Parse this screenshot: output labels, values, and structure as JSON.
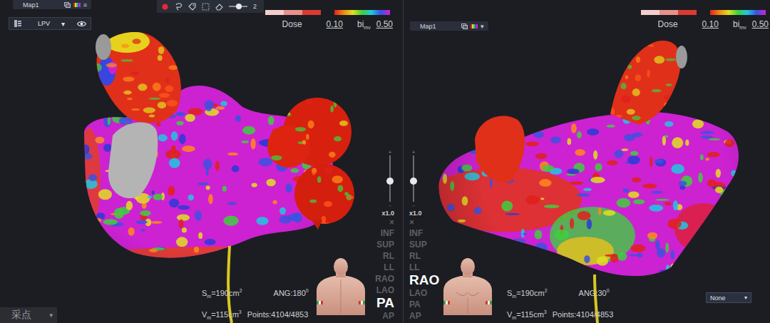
{
  "viewports": [
    {
      "map_selector": {
        "label": "Map1",
        "arrow": "≡"
      },
      "layer": {
        "label": "LPV",
        "arrow": "▾",
        "visible": true
      },
      "toolbar": {
        "tools": [
          {
            "kind": "record"
          },
          {
            "kind": "lasso"
          },
          {
            "kind": "tag"
          },
          {
            "kind": "select"
          },
          {
            "kind": "erase"
          }
        ],
        "brush_level": 0.55,
        "brush_value": "2"
      },
      "legend": {
        "dose_label": "Dose",
        "dose_min": "0.10",
        "unit": "bi",
        "unit_sub": "mv",
        "max": "0.50"
      },
      "zoom": {
        "plus": "+",
        "minus": "-",
        "level": 0.45,
        "reading": "x1.0"
      },
      "close": "×",
      "views": [
        {
          "label": "INF",
          "selected": false
        },
        {
          "label": "SUP",
          "selected": false
        },
        {
          "label": "RL",
          "selected": false
        },
        {
          "label": "LL",
          "selected": false
        },
        {
          "label": "RAO",
          "selected": false
        },
        {
          "label": "LAO",
          "selected": false
        },
        {
          "label": "PA",
          "selected": true
        },
        {
          "label": "AP",
          "selected": false
        }
      ],
      "figure": "back",
      "stats": {
        "area": {
          "symbol": "S",
          "sub": "m",
          "value": "=190cm",
          "sup": "2"
        },
        "angle": {
          "value": "ANG:180",
          "sup": "0"
        },
        "volume": {
          "symbol": "V",
          "sub": "m",
          "value": "=115cm",
          "sup": "3"
        },
        "points": "Points:4104/4853"
      }
    },
    {
      "map_selector": {
        "label": "Map1",
        "arrow": "▾"
      },
      "legend": {
        "dose_label": "Dose",
        "dose_min": "0.10",
        "unit": "bi",
        "unit_sub": "mv",
        "max": "0.50"
      },
      "zoom": {
        "plus": "+",
        "minus": "-",
        "level": 0.45,
        "reading": "x1.0"
      },
      "close": "×",
      "views": [
        {
          "label": "INF",
          "selected": false
        },
        {
          "label": "SUP",
          "selected": false
        },
        {
          "label": "RL",
          "selected": false
        },
        {
          "label": "LL",
          "selected": false
        },
        {
          "label": "RAO",
          "selected": true
        },
        {
          "label": "LAO",
          "selected": false
        },
        {
          "label": "PA",
          "selected": false
        },
        {
          "label": "AP",
          "selected": false
        }
      ],
      "figure": "front",
      "stats": {
        "area": {
          "symbol": "S",
          "sub": "m",
          "value": "=190cm",
          "sup": "2"
        },
        "angle": {
          "value": "ANG:30",
          "sup": "0"
        },
        "volume": {
          "symbol": "V",
          "sub": "m",
          "value": "=115cm",
          "sup": "3"
        },
        "points": "Points:4104/4853"
      },
      "shading": {
        "label": "None",
        "arrow": "▾"
      }
    }
  ],
  "capture_menu": {
    "label": "采点",
    "arrow": "▾"
  }
}
